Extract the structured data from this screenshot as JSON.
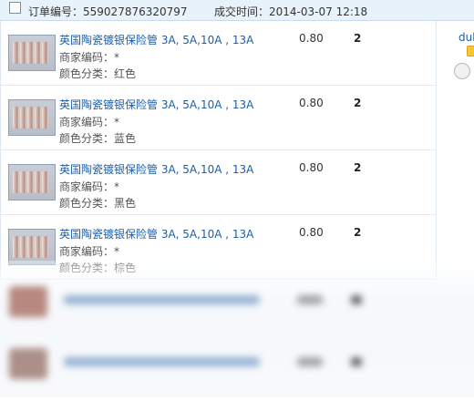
{
  "header": {
    "order_no_label": "订单编号：",
    "order_no": "559027876320797",
    "deal_time_label": "成交时间：",
    "deal_time": "2014-03-07 12:18"
  },
  "items": [
    {
      "title": "英国陶瓷镀银保险管 3A, 5A,10A , 13A",
      "merchant": "商家编码：*",
      "color": "颜色分类：红色",
      "price": "0.80",
      "qty": "2"
    },
    {
      "title": "英国陶瓷镀银保险管 3A, 5A,10A , 13A",
      "merchant": "商家编码：*",
      "color": "颜色分类：蓝色",
      "price": "0.80",
      "qty": "2"
    },
    {
      "title": "英国陶瓷镀银保险管 3A, 5A,10A , 13A",
      "merchant": "商家编码：*",
      "color": "颜色分类：黑色",
      "price": "0.80",
      "qty": "2"
    },
    {
      "title": "英国陶瓷镀银保险管 3A, 5A,10A , 13A",
      "merchant": "商家编码：*",
      "color": "颜色分类：棕色",
      "price": "0.80",
      "qty": "2"
    }
  ],
  "seller": {
    "name": "duk"
  },
  "colors": {
    "link_blue": "#1d5ea8",
    "header_bg": "#e8f2fb"
  }
}
